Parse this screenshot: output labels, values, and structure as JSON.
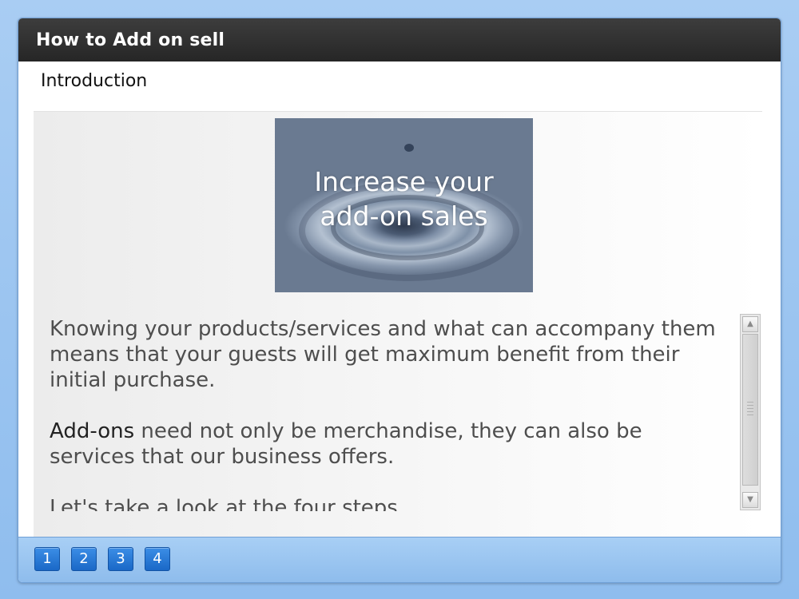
{
  "window": {
    "title": "How to Add on sell"
  },
  "section": {
    "title": "Introduction"
  },
  "hero": {
    "line1": "Increase your",
    "line2": "add-on sales"
  },
  "body": {
    "paragraph1": "Knowing your products/services and what can accompany them means that your guests will get maximum benefit from their initial purchase.",
    "paragraph2_strong": "Add-ons",
    "paragraph2_rest": " need not only be merchandise, they can also be services that our business offers.",
    "paragraph3": "Let's take a look at the four steps"
  },
  "scrollbar": {
    "up_arrow": "▲",
    "down_arrow": "▼"
  },
  "pagination": {
    "pages": [
      "1",
      "2",
      "3",
      "4"
    ]
  },
  "colors": {
    "titlebar": "#2e2e2e",
    "footer": "#9cc6f1",
    "page_button": "#2a7bd8"
  }
}
